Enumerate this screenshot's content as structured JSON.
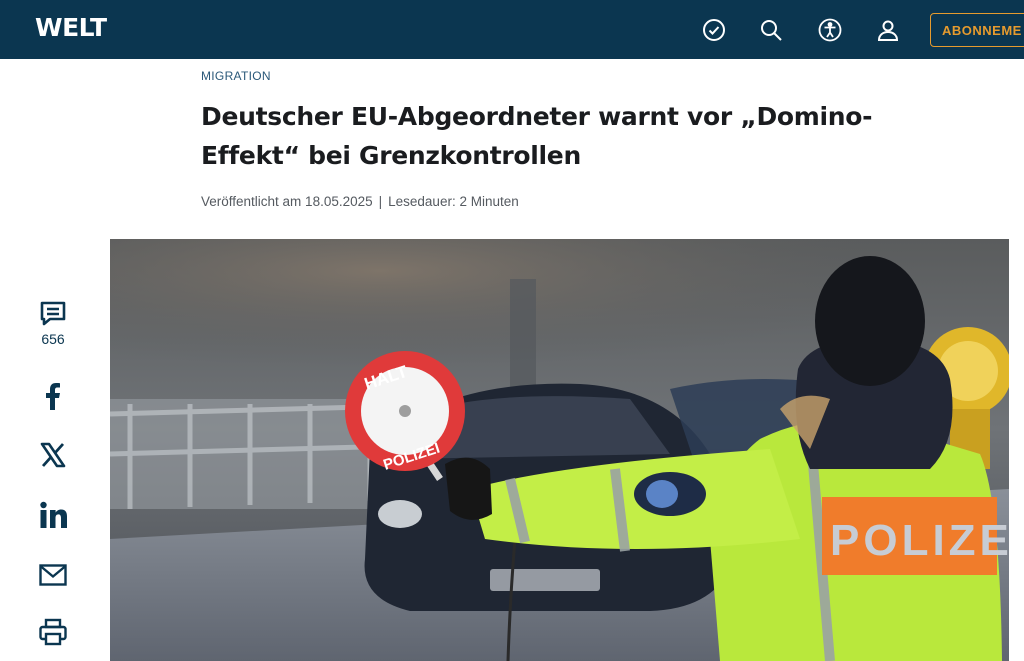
{
  "header": {
    "logo": "WELT",
    "icons": [
      "check-circle-icon",
      "search-icon",
      "accessibility-icon",
      "user-icon"
    ],
    "subscribe_label": "ABONNEME",
    "colors": {
      "bar": "#0b3650",
      "accent": "#e69b2e"
    }
  },
  "article": {
    "kicker": "MIGRATION",
    "headline": "Deutscher EU-Abgeordneter warnt vor „Domino-Effekt“ bei Grenzkontrollen",
    "published": "Veröffentlicht am 18.05.2025",
    "separator": "|",
    "reading_time": "Lesedauer: 2 Minuten"
  },
  "share": {
    "comment_count": "656",
    "buttons": [
      "comment-icon",
      "facebook-icon",
      "x-icon",
      "linkedin-icon",
      "mail-icon",
      "print-icon"
    ]
  },
  "hero": {
    "sign_top": "HALT",
    "sign_bottom": "POLIZEI",
    "vest_label": "POLIZE"
  }
}
